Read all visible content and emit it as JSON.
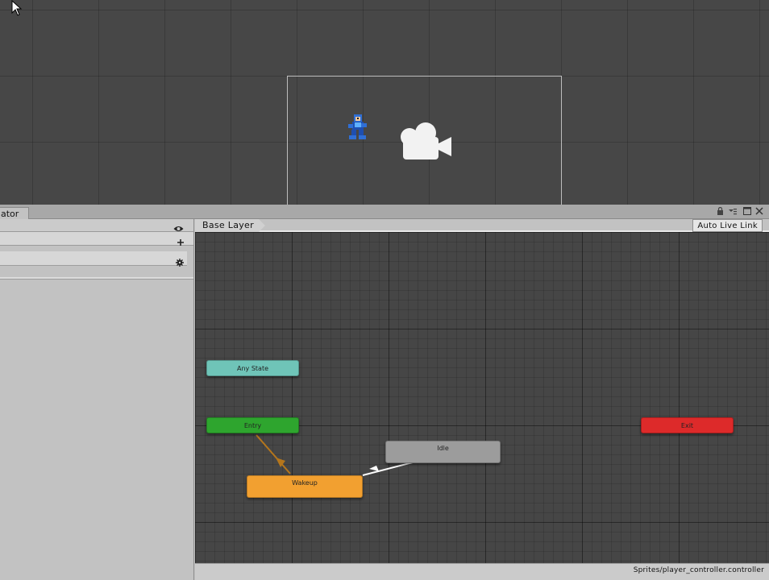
{
  "animator": {
    "tab_label": "ator",
    "breadcrumb": "Base Layer",
    "auto_live_link": "Auto Live Link",
    "controller_path": "Sprites/player_controller.controller"
  },
  "states": {
    "any_state": "Any State",
    "entry": "Entry",
    "exit": "Exit",
    "idle": "Idle",
    "wakeup": "Wakeup"
  },
  "colors": {
    "any_state": "#6fc4b8",
    "entry": "#2ea52e",
    "exit": "#dd2a2a",
    "idle": "#9c9c9c",
    "wakeup": "#f2a030"
  },
  "icons": {
    "eye": "eye-icon",
    "plus": "plus-icon",
    "gear": "gear-icon",
    "lock": "lock-icon",
    "menu": "menu-icon",
    "maximize": "maximize-icon",
    "close": "close-icon",
    "camera": "camera-icon",
    "cursor": "cursor-icon"
  }
}
